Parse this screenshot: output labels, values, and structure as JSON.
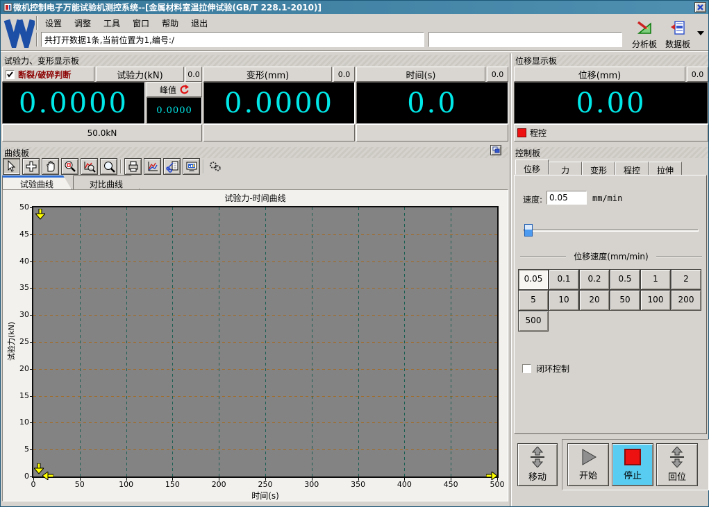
{
  "window": {
    "title": "微机控制电子万能试验机测控系统--[金属材料室温拉伸试验(GB/T 228.1-2010)]"
  },
  "menu": {
    "items": [
      "设置",
      "调整",
      "工具",
      "窗口",
      "帮助",
      "退出"
    ]
  },
  "toolbar": {
    "status_message": "共打开数据1条,当前位置为1,编号:/",
    "analysis_button": "分析板",
    "data_button": "数据板"
  },
  "display_board": {
    "title": "试验力、变形显示板",
    "force": {
      "break_check_label": "断裂/破碎判断",
      "header": "试验力(kN)",
      "aux_value": "0.0",
      "value": "0.0000",
      "peak_label": "峰值",
      "peak_value": "0.0000",
      "range_label": "50.0kN"
    },
    "deform": {
      "header": "变形(mm)",
      "aux_value": "0.0",
      "value": "0.0000"
    },
    "time": {
      "header": "时间(s)",
      "aux_value": "0.0",
      "value": "0.0"
    }
  },
  "displacement_board": {
    "title": "位移显示板",
    "header": "位移(mm)",
    "aux_value": "0.0",
    "value": "0.00",
    "mode_label": "程控"
  },
  "curve_board": {
    "title": "曲线板",
    "tabs": [
      "试验曲线",
      "对比曲线"
    ],
    "active_tab": "试验曲线"
  },
  "chart_data": {
    "type": "line",
    "title": "试验力-时间曲线",
    "xlabel": "时间(s)",
    "ylabel": "试验力(kN)",
    "xlim": [
      0,
      500
    ],
    "ylim": [
      0,
      50
    ],
    "x_ticks": [
      0,
      50,
      100,
      150,
      200,
      250,
      300,
      350,
      400,
      450,
      500
    ],
    "y_ticks": [
      0,
      5,
      10,
      15,
      20,
      25,
      30,
      35,
      40,
      45,
      50
    ],
    "grid": true,
    "legend": false,
    "series": []
  },
  "control_board": {
    "title": "控制板",
    "tabs": [
      "位移",
      "力",
      "变形",
      "程控",
      "拉伸"
    ],
    "active_tab": "位移",
    "speed_label": "速度:",
    "speed_value": "0.05",
    "speed_unit": "mm/min",
    "speed_group_label": "位移速度(mm/min)",
    "speed_buttons": [
      "0.05",
      "0.1",
      "0.2",
      "0.5",
      "1",
      "2",
      "5",
      "10",
      "20",
      "50",
      "100",
      "200",
      "500"
    ],
    "selected_speed": "0.05",
    "closed_loop_label": "闭环控制",
    "buttons": {
      "move": "移动",
      "start": "开始",
      "stop": "停止",
      "home": "回位"
    }
  },
  "colors": {
    "titlebar": "#3a7c9e",
    "digit_cyan": "#00e8e8",
    "plot_background": "#838383",
    "grid_horizontal": "#a5691f",
    "grid_vertical": "#1b5f53",
    "axis_marker": "#ffff00",
    "stop_button_background": "#58cdf1",
    "stop_icon": "#ee1111",
    "break_text": "#8b0000",
    "program_control_red": "#ee1111"
  }
}
